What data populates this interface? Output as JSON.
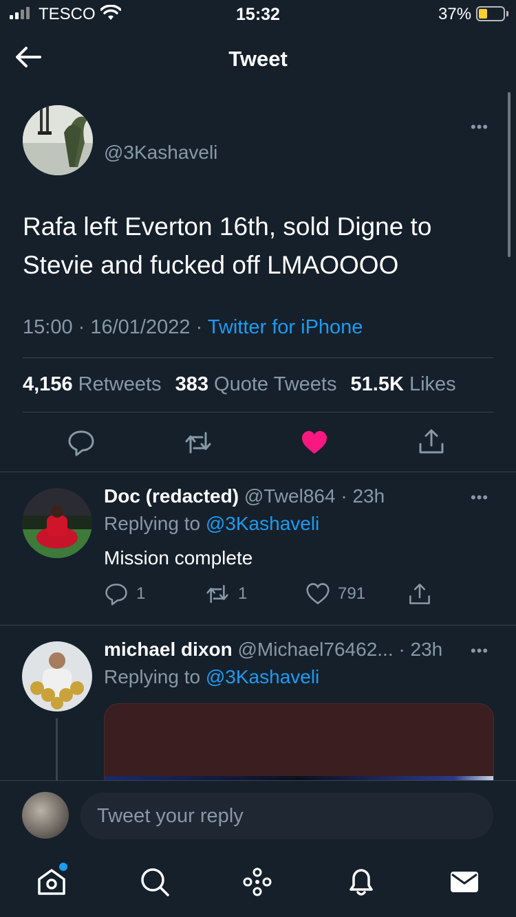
{
  "status_bar": {
    "carrier": "TESCO",
    "time": "15:32",
    "battery": "37%"
  },
  "header": {
    "title": "Tweet"
  },
  "tweet": {
    "handle": "@3Kashaveli",
    "text": "Rafa left Everton 16th, sold Digne to Stevie and fucked off LMAOOOO",
    "time": "15:00",
    "date": "16/01/2022",
    "source": "Twitter for iPhone",
    "retweets_count": "4,156",
    "retweets_label": "Retweets",
    "quotes_count": "383",
    "quotes_label": "Quote Tweets",
    "likes_count": "51.5K",
    "likes_label": "Likes",
    "liked": true
  },
  "replies": [
    {
      "name": "Doc (redacted)",
      "handle": "@Twel864",
      "age": "23h",
      "replying_prefix": "Replying to",
      "replying_to": "@3Kashaveli",
      "text": "Mission complete",
      "reply_count": "1",
      "retweet_count": "1",
      "like_count": "791"
    },
    {
      "name": "michael dixon",
      "handle": "@Michael76462...",
      "age": "23h",
      "replying_prefix": "Replying to",
      "replying_to": "@3Kashaveli"
    }
  ],
  "composer": {
    "placeholder": "Tweet your reply"
  },
  "nav": [
    "home-icon",
    "search-icon",
    "spaces-icon",
    "notifications-icon",
    "messages-icon"
  ],
  "colors": {
    "background": "#15202b",
    "accent": "#1d9bf0",
    "like": "#f91880",
    "muted": "#8899a6"
  }
}
